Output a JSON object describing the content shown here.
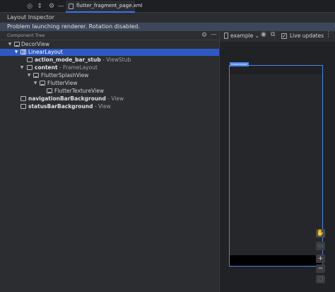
{
  "tab": {
    "file_name": "flutter_fragment_page.xml"
  },
  "header": {
    "title": "Layout Inspector"
  },
  "banner": {
    "message": "Problem launching renderer. Rotation disabled."
  },
  "component_tree": {
    "title": "Component Tree",
    "nodes": [
      {
        "name": "DecorView",
        "type": ""
      },
      {
        "name": "LinearLayout",
        "type": ""
      },
      {
        "name": "action_mode_bar_stub",
        "type": " - ViewStub"
      },
      {
        "name": "content",
        "type": " - FrameLayout"
      },
      {
        "name": "FlutterSplashView",
        "type": ""
      },
      {
        "name": "FlutterView",
        "type": ""
      },
      {
        "name": "FlutterTextureView",
        "type": ""
      },
      {
        "name": "navigationBarBackground",
        "type": " - View"
      },
      {
        "name": "statusBarBackground",
        "type": " - View"
      }
    ]
  },
  "preview": {
    "device": "example",
    "live_updates_label": "Live updates",
    "live_updates_checked": true,
    "selected_tag": "LinearLayout"
  },
  "colors": {
    "selection": "#2e59c4",
    "accent": "#4b86e8",
    "banner": "#3d4759"
  }
}
